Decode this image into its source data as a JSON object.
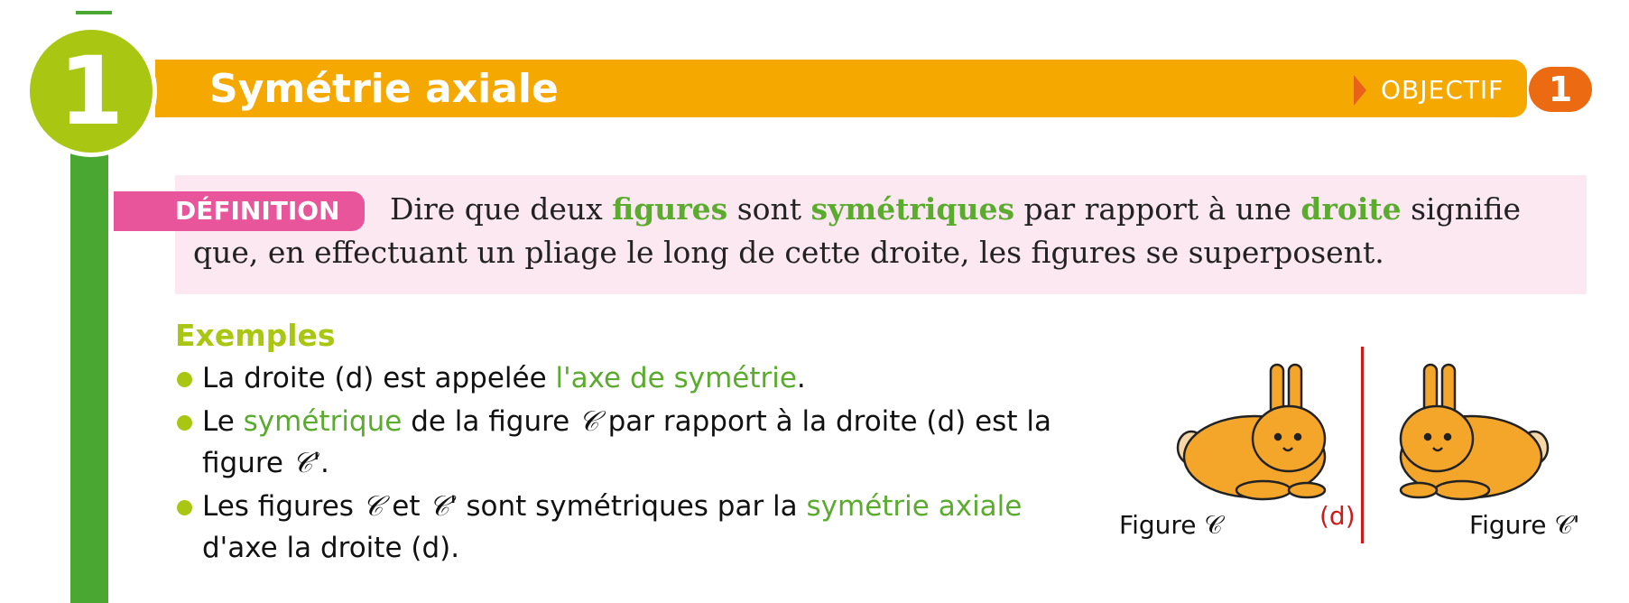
{
  "badge": {
    "number": "1"
  },
  "header": {
    "title": "Symétrie axiale",
    "objective_label": "OBJECTIF",
    "objective_number": "1"
  },
  "definition": {
    "tag": "DÉFINITION",
    "t1": "Dire que deux ",
    "k1": "figures",
    "t2": " sont ",
    "k2": "symétriques",
    "t3": " par rapport à une ",
    "k3": "droite",
    "t4": " signifie que, en effectuant un pliage le long de cette droite, les figures se superposent."
  },
  "examples": {
    "title": "Exemples",
    "item1": {
      "t1": "La droite (d) est appelée ",
      "k1": "l'axe de symétrie",
      "t2": "."
    },
    "item2": {
      "t1": "Le ",
      "k1": "symétrique",
      "t2": " de la figure ",
      "f1": "𝒞",
      "t3": " par rapport à la droite (d) est la figure ",
      "f2": "𝒞'",
      "t4": "."
    },
    "item3": {
      "t1": "Les figures ",
      "f1": "𝒞",
      "t2": " et ",
      "f2": "𝒞'",
      "t3": " sont symétriques par la ",
      "k1": "symétrie axiale",
      "t4": " d'axe la droite (d)."
    }
  },
  "figure": {
    "axis_label": "(d)",
    "left_label": "Figure 𝒞",
    "right_label": "Figure 𝒞'",
    "rabbit_color": "#f4a62a"
  }
}
